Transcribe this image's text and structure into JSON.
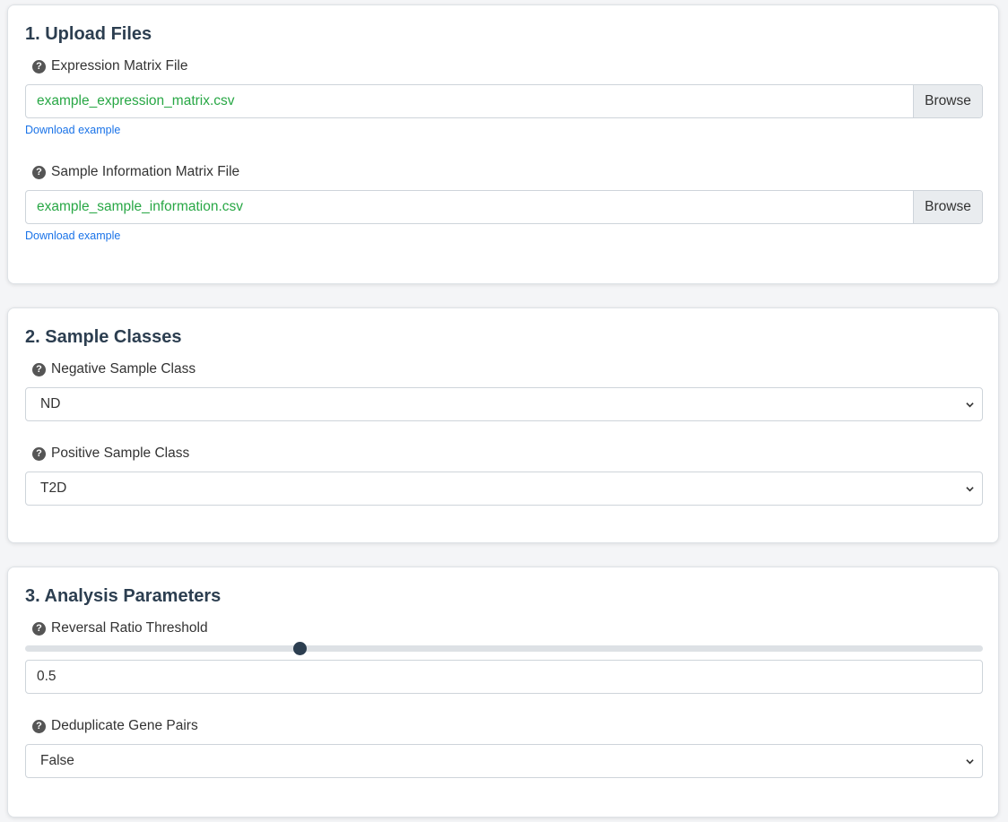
{
  "upload": {
    "title": "1. Upload Files",
    "expression": {
      "label": "Expression Matrix File",
      "file_name": "example_expression_matrix.csv",
      "browse_label": "Browse",
      "link": "Download example"
    },
    "sample_info": {
      "label": "Sample Information Matrix File",
      "file_name": "example_sample_information.csv",
      "browse_label": "Browse",
      "link": "Download example"
    }
  },
  "classes": {
    "title": "2. Sample Classes",
    "negative": {
      "label": "Negative Sample Class",
      "value": "ND"
    },
    "positive": {
      "label": "Positive Sample Class",
      "value": "T2D"
    }
  },
  "params": {
    "title": "3. Analysis Parameters",
    "threshold": {
      "label": "Reversal Ratio Threshold",
      "slider_fraction": 0.287,
      "value": "0.5"
    },
    "dedup": {
      "label": "Deduplicate Gene Pairs",
      "value": "False"
    }
  },
  "icons": {
    "help": "question-circle-icon",
    "dropdown": "chevron-down-icon"
  },
  "colors": {
    "file_name": "#28a745",
    "link": "#1a73e8",
    "slider_thumb": "#2c3e50"
  }
}
